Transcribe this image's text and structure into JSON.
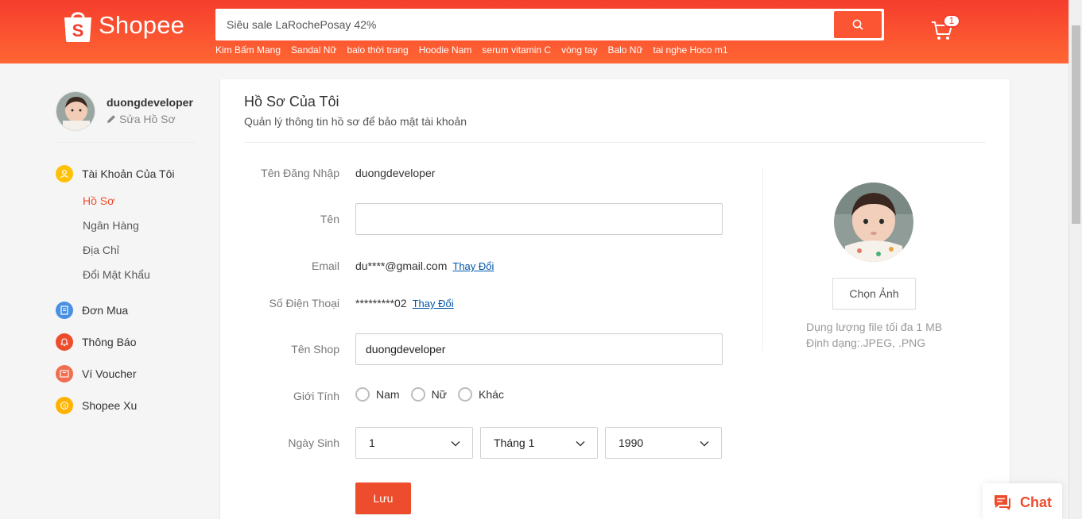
{
  "header": {
    "logo_text": "Shopee",
    "search_placeholder": "Siêu sale LaRochePosay 42%",
    "suggestions": [
      "Kim Bấm Mang",
      "Sandal Nữ",
      "balo thời trang",
      "Hoodie Nam",
      "serum vitamin C",
      "vòng tay",
      "Balo Nữ",
      "tai nghe Hoco m1"
    ],
    "cart_count": "1",
    "brand_color": "#ee4d2d"
  },
  "sidebar": {
    "username": "duongdeveloper",
    "edit_label": "Sửa Hồ Sơ",
    "account_label": "Tài Khoản Của Tôi",
    "submenu": [
      {
        "label": "Hồ Sơ",
        "active": true
      },
      {
        "label": "Ngân Hàng",
        "active": false
      },
      {
        "label": "Địa Chỉ",
        "active": false
      },
      {
        "label": "Đổi Mật Khẩu",
        "active": false
      }
    ],
    "orders_label": "Đơn Mua",
    "notifications_label": "Thông Báo",
    "voucher_label": "Ví Voucher",
    "coins_label": "Shopee Xu"
  },
  "profile": {
    "title": "Hồ Sơ Của Tôi",
    "subtitle": "Quản lý thông tin hồ sơ để bảo mật tài khoản",
    "username_label": "Tên Đăng Nhập",
    "username_value": "duongdeveloper",
    "name_label": "Tên",
    "name_value": "",
    "email_label": "Email",
    "email_value": "du****@gmail.com",
    "phone_label": "Số Điện Thoại",
    "phone_value": "*********02",
    "change_label": "Thay Đổi",
    "shop_label": "Tên Shop",
    "shop_value": "duongdeveloper",
    "gender_label": "Giới Tính",
    "gender_options": [
      "Nam",
      "Nữ",
      "Khác"
    ],
    "birthday_label": "Ngày Sinh",
    "birthday_day": "1",
    "birthday_month": "Tháng 1",
    "birthday_year": "1990",
    "save_label": "Lưu",
    "choose_image_label": "Chọn Ảnh",
    "file_size_note": "Dụng lượng file tối đa 1 MB",
    "file_format_note": "Định dạng:.JPEG, .PNG"
  },
  "chat": {
    "label": "Chat"
  }
}
